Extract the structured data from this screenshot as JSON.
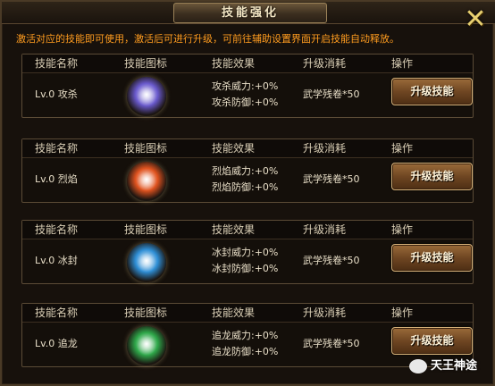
{
  "window": {
    "title": "技能强化",
    "close_icon": "close-x-icon",
    "notice": "激活对应的技能即可使用，激活后可进行升级，可前往辅助设置界面开启技能自动释放。"
  },
  "headers": {
    "name": "技能名称",
    "icon": "技能图标",
    "effect": "技能效果",
    "cost": "升级消耗",
    "action": "操作"
  },
  "skills": [
    {
      "name": "Lv.0 攻杀",
      "icon": "gongsha-skill-icon",
      "effect1": "攻杀威力:+0%",
      "effect2": "攻杀防御:+0%",
      "cost": "武学残卷*50",
      "button": "升级技能",
      "color": "#6a5acd"
    },
    {
      "name": "Lv.0 烈焰",
      "icon": "lieyan-skill-icon",
      "effect1": "烈焰威力:+0%",
      "effect2": "烈焰防御:+0%",
      "cost": "武学残卷*50",
      "button": "升级技能",
      "color": "#e0531f"
    },
    {
      "name": "Lv.0 冰封",
      "icon": "bingfeng-skill-icon",
      "effect1": "冰封威力:+0%",
      "effect2": "冰封防御:+0%",
      "cost": "武学残卷*50",
      "button": "升级技能",
      "color": "#2f8fd6"
    },
    {
      "name": "Lv.0 追龙",
      "icon": "zhuilong-skill-icon",
      "effect1": "追龙威力:+0%",
      "effect2": "追龙防御:+0%",
      "cost": "武学残卷*50",
      "button": "升级技能",
      "color": "#2fa84a"
    }
  ],
  "watermark": "天王神途"
}
